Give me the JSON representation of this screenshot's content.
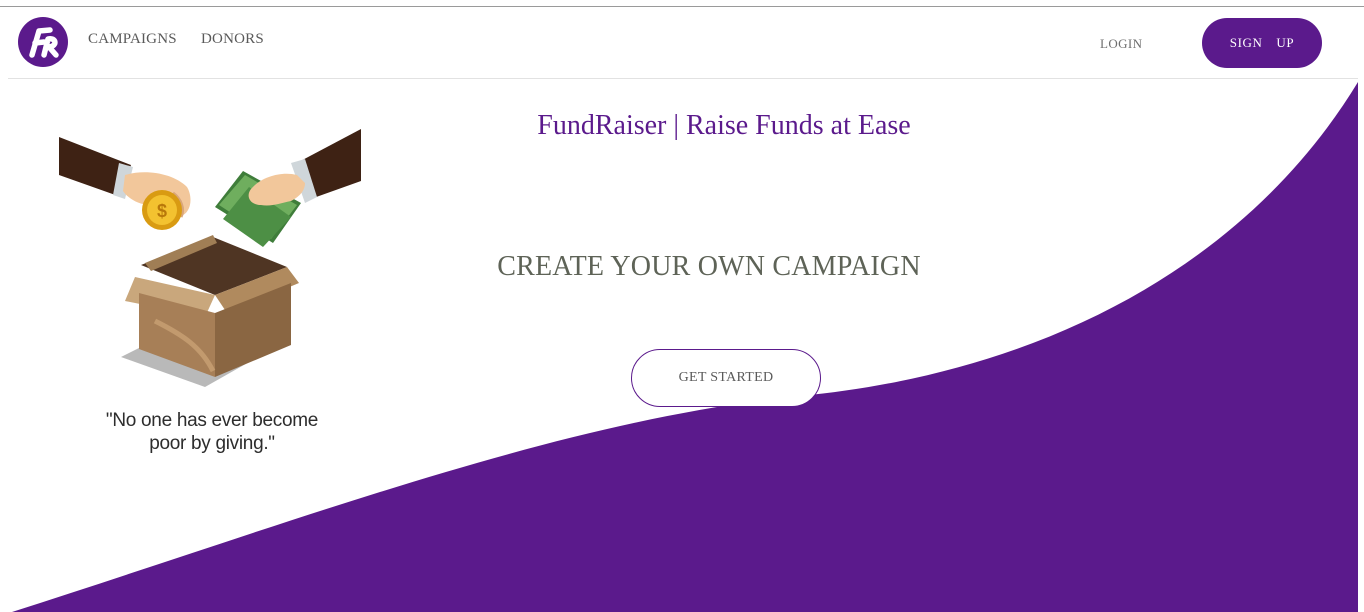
{
  "brand": {
    "logo_text": "FR",
    "color": "#5b1a8c"
  },
  "nav": {
    "links": [
      {
        "label": "CAMPAIGNS"
      },
      {
        "label": "DONORS"
      }
    ],
    "login_label": "LOGIN",
    "signup_label": "SIGN UP"
  },
  "hero": {
    "title": "FundRaiser | Raise Funds at Ease",
    "subtitle": "CREATE YOUR OWN CAMPAIGN",
    "cta_label": "GET STARTED",
    "quote_line1": "\"No one has ever become",
    "quote_line2": "poor by giving.\""
  },
  "illustration": {
    "icon": "donation-box-illustration",
    "coin_symbol": "$"
  },
  "colors": {
    "accent": "#5b1a8c",
    "subtitle_text": "#5e6357",
    "background": "#ffffff"
  }
}
